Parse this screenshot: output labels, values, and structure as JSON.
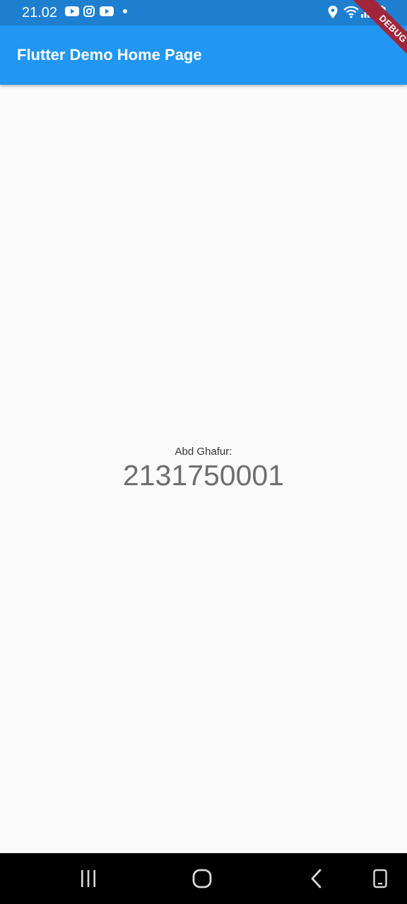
{
  "status_bar": {
    "time": "21.02",
    "left_icons": [
      "youtube-icon",
      "instagram-icon",
      "youtube-icon",
      "dot-icon"
    ],
    "right_icons": [
      "location-icon",
      "wifi-icon",
      "signal-icon",
      "battery-icon"
    ]
  },
  "app_bar": {
    "title": "Flutter Demo Home Page",
    "color": "#2196f3"
  },
  "debug_banner": {
    "label": "DEBUG",
    "color": "#a1253b"
  },
  "main": {
    "label": "Abd Ghafur:",
    "value": "2131750001"
  },
  "nav_bar": {
    "buttons": [
      "recent-apps-icon",
      "home-icon",
      "back-icon",
      "rotate-icon"
    ]
  }
}
